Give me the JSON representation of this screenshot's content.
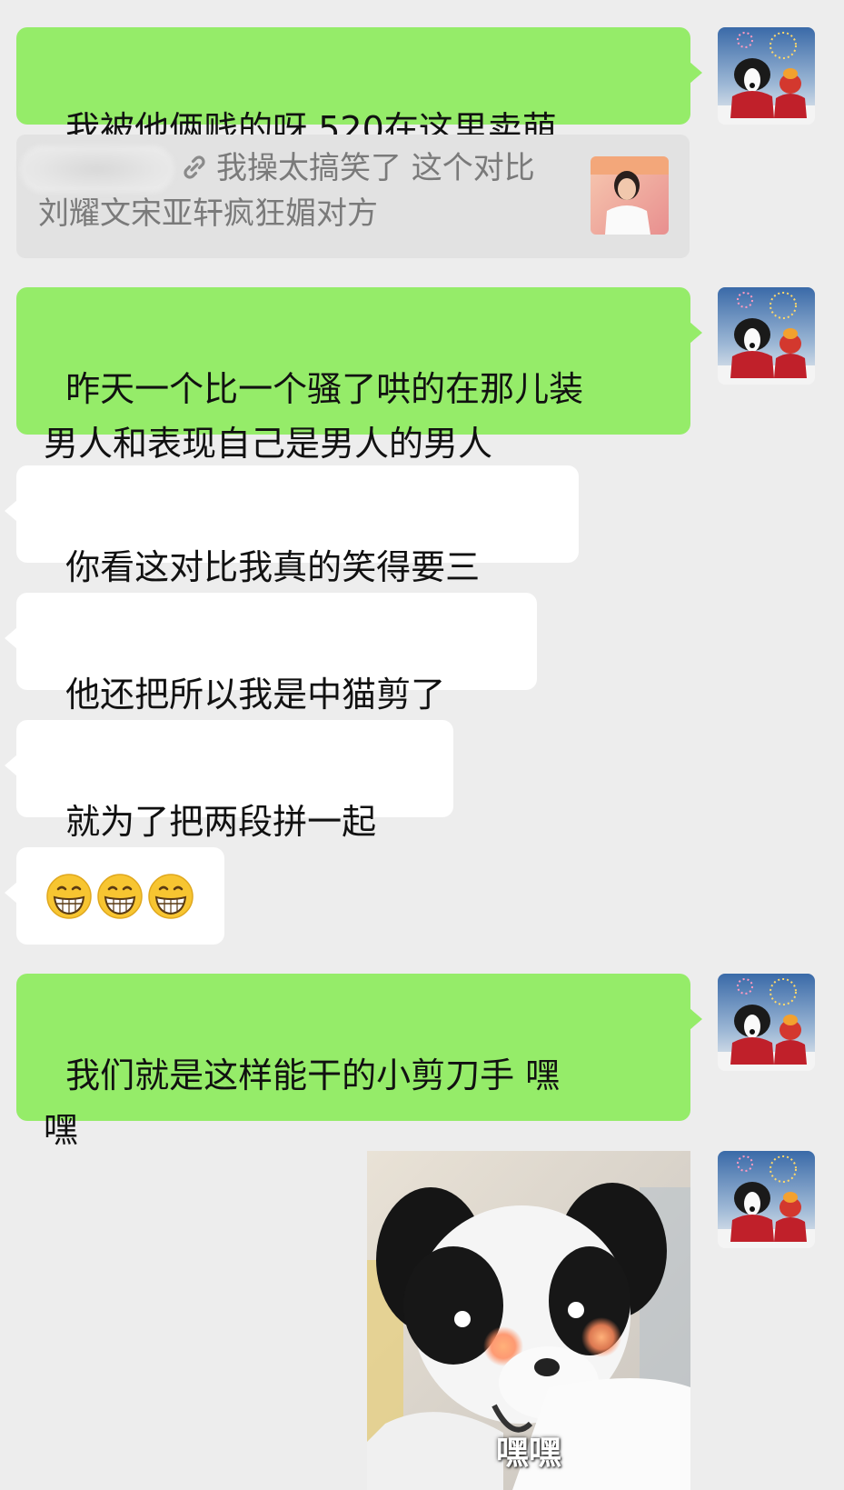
{
  "messages": {
    "m1": {
      "text": "我被他俩贱的呀 520在这里卖萌"
    },
    "quote": {
      "prefix": "我操太搞笑了 这个对比",
      "line2": "刘耀文宋亚轩疯狂媚对方"
    },
    "m2": {
      "text": "昨天一个比一个骚了哄的在那儿装\n男人和表现自己是男人的男人"
    },
    "m3": {
      "text": "你看这对比我真的笑得要三"
    },
    "m4": {
      "text": "他还把所以我是中猫剪了"
    },
    "m5": {
      "text": "就为了把两段拼一起"
    },
    "m6": {
      "emojis": [
        "grin-emoji",
        "grin-emoji",
        "grin-emoji"
      ]
    },
    "m7": {
      "text": "我们就是这样能干的小剪刀手 嘿\n嘿"
    },
    "m8": {
      "caption": "嘿嘿"
    }
  },
  "colors": {
    "background": "#ededed",
    "sent_bubble": "#95ec69",
    "received_bubble": "#ffffff",
    "quote_bg": "#e2e2e2",
    "quote_text": "#7a7a7a"
  },
  "icons": {
    "link": "link-icon",
    "avatar": "avatar-dog-in-red-sweater"
  }
}
